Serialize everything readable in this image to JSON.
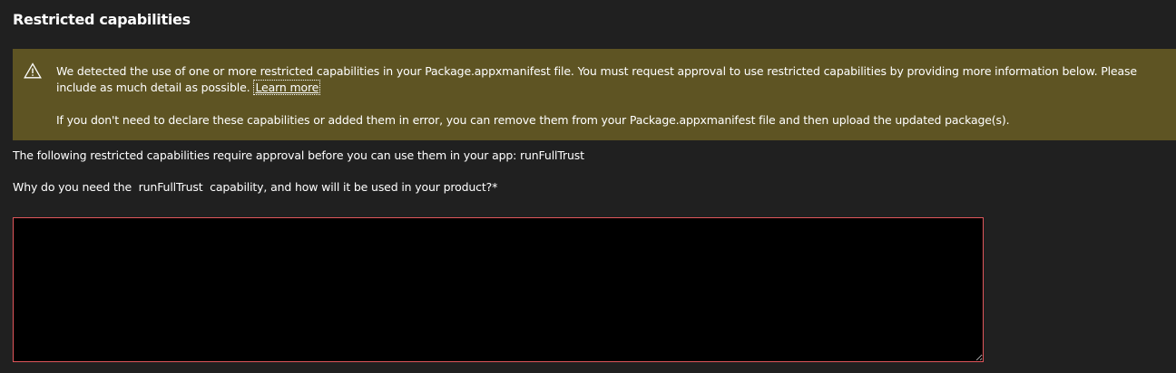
{
  "section": {
    "title": "Restricted capabilities"
  },
  "warning": {
    "icon": "warning-icon",
    "paragraph1_text": "We detected the use of one or more restricted capabilities in your Package.appxmanifest file. You must request approval to use restricted capabilities by providing more information below. Please include as much detail as possible.",
    "learn_more_label": "Learn more",
    "paragraph2_text": "If you don't need to declare these capabilities or added them in error, you can remove them from your Package.appxmanifest file and then upload the updated package(s).",
    "background_color": "#5e5423"
  },
  "form": {
    "capabilities_line": "The following restricted capabilities require approval before you can use them in your app: runFullTrust",
    "question_label": "Why do you need the  runFullTrust  capability, and how will it be used in your product?*",
    "answer_value": "",
    "answer_border_color": "#e0565b"
  }
}
